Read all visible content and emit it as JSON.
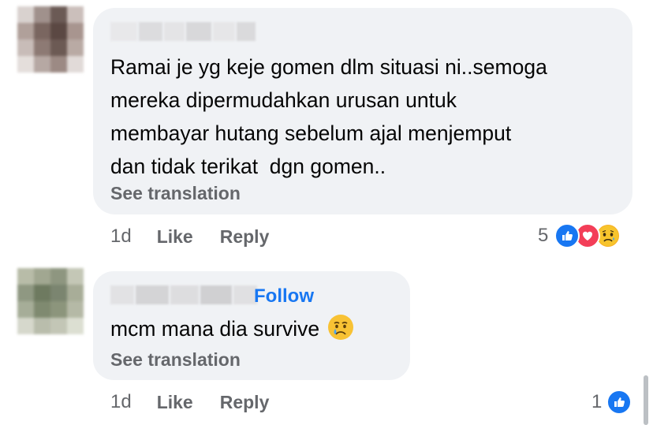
{
  "comments": [
    {
      "text": "Ramai je yg keje gomen dlm situasi ni..semoga\nmereka dipermudahkan urusan untuk\nmembayar hutang sebelum ajal menjemput\ndan tidak terikat  dgn gomen..",
      "see_translation": "See translation",
      "time": "1d",
      "like_label": "Like",
      "reply_label": "Reply",
      "reaction_count": "5",
      "reactions": [
        "like-icon",
        "love-icon",
        "sad-icon"
      ]
    },
    {
      "follow_label": "Follow",
      "text": "mcm mana dia survive",
      "see_translation": "See translation",
      "time": "1d",
      "like_label": "Like",
      "reply_label": "Reply",
      "reaction_count": "1",
      "reactions": [
        "like-icon"
      ]
    }
  ],
  "colors": {
    "bubble_bg": "#f0f2f5",
    "secondary_text": "#65676b",
    "link_blue": "#1877f2",
    "like_blue": "#1877f2",
    "love_red": "#f33e58",
    "sad_yellow": "#f7b125"
  }
}
